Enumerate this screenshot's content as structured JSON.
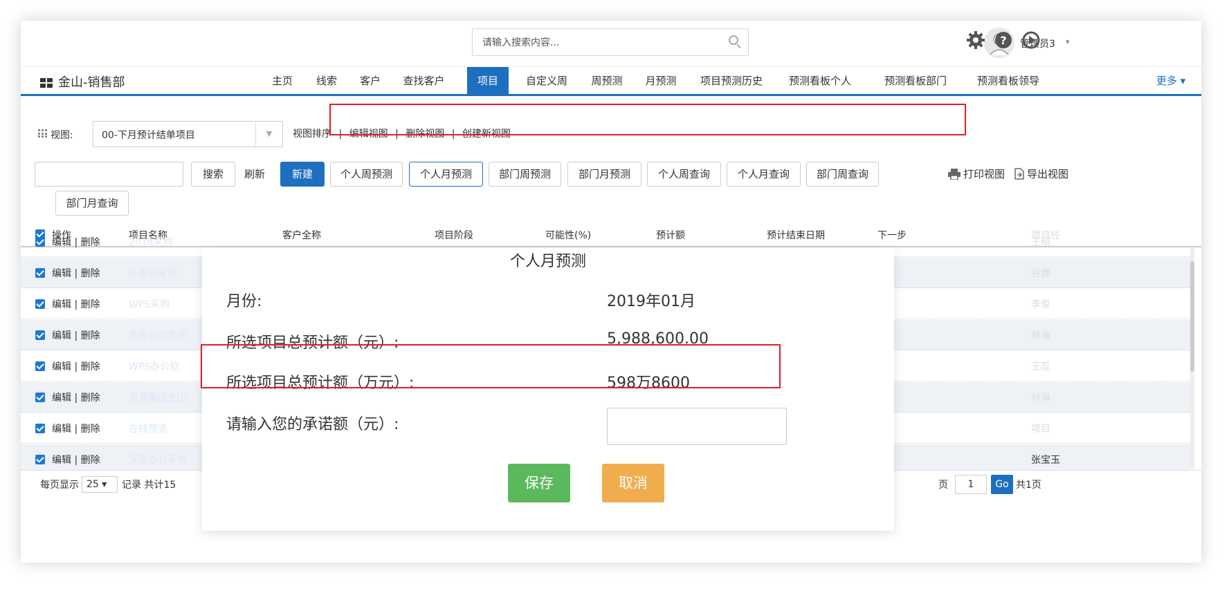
{
  "header": {
    "search_placeholder": "请输入搜索内容...",
    "user_name": "管理员3",
    "caret": "▾"
  },
  "nav": {
    "brand": "金山-销售部",
    "tabs": [
      "主页",
      "线索",
      "客户",
      "查找客户",
      "项目",
      "自定义周",
      "周预测",
      "月预测",
      "项目预测历史",
      "预测看板个人",
      "预测看板部门",
      "预测看板领导"
    ],
    "active_tab": "项目",
    "more": "更多 ▾"
  },
  "viewbar": {
    "label": "视图:",
    "selected_view": "00-下月预计结单项目",
    "sort_label": "视图排序",
    "edit_view": "编辑视图",
    "delete_view": "删除视图",
    "create_view": "创建新视图"
  },
  "toolbar": {
    "search": "搜索",
    "refresh": "刷新",
    "new": "新建",
    "buttons": [
      "个人周预测",
      "个人月预测",
      "部门周预测",
      "部门月预测",
      "个人周查询",
      "个人月查询",
      "部门周查询",
      "部门月查询"
    ],
    "selected_button": "个人月预测",
    "print_view": "打印视图",
    "export_view": "导出视图"
  },
  "grid": {
    "headers": [
      "操作",
      "项目名称",
      "客户全称",
      "项目阶段",
      "可能性(%)",
      "预计额",
      "预计结束日期",
      "下一步",
      "项目经"
    ],
    "row_ops": "编辑 | 删除",
    "rows": [
      {
        "name": "2018采购",
        "person": "王绍"
      },
      {
        "name": "正版化采购",
        "person": "谷娜"
      },
      {
        "name": "WPS采购",
        "person": "李俊"
      },
      {
        "name": "青岛公交集团",
        "person": "林海"
      },
      {
        "name": "WPS办公软",
        "person": "王蕊"
      },
      {
        "name": "浪潮集团金山",
        "person": "林海"
      },
      {
        "name": "在线预览",
        "person": "项目"
      },
      {
        "name": "保密办公系统",
        "person": "张宝玉"
      }
    ]
  },
  "footer": {
    "per_page_label": "每页显示",
    "per_page": "25 ▾",
    "records_label": "记录  共计15",
    "page_label": "页",
    "page_num": "1",
    "go": "Go",
    "total_pages": "共1页"
  },
  "modal": {
    "title": "个人月预测",
    "month_label": "月份:",
    "month_value": "2019年01月",
    "total_yuan_label": "所选项目总预计额（元）:",
    "total_yuan_value": "5,988,600.00",
    "total_wan_label": "所选项目总预计额（万元）:",
    "total_wan_value": "598万8600",
    "commit_label": "请输入您的承诺额（元）:",
    "save": "保存",
    "cancel": "取消"
  },
  "colors": {
    "brand_blue": "#1e6fbf",
    "highlight_red": "#e01e1e",
    "save_green": "#5cb85c",
    "cancel_orange": "#f0ad4e"
  }
}
